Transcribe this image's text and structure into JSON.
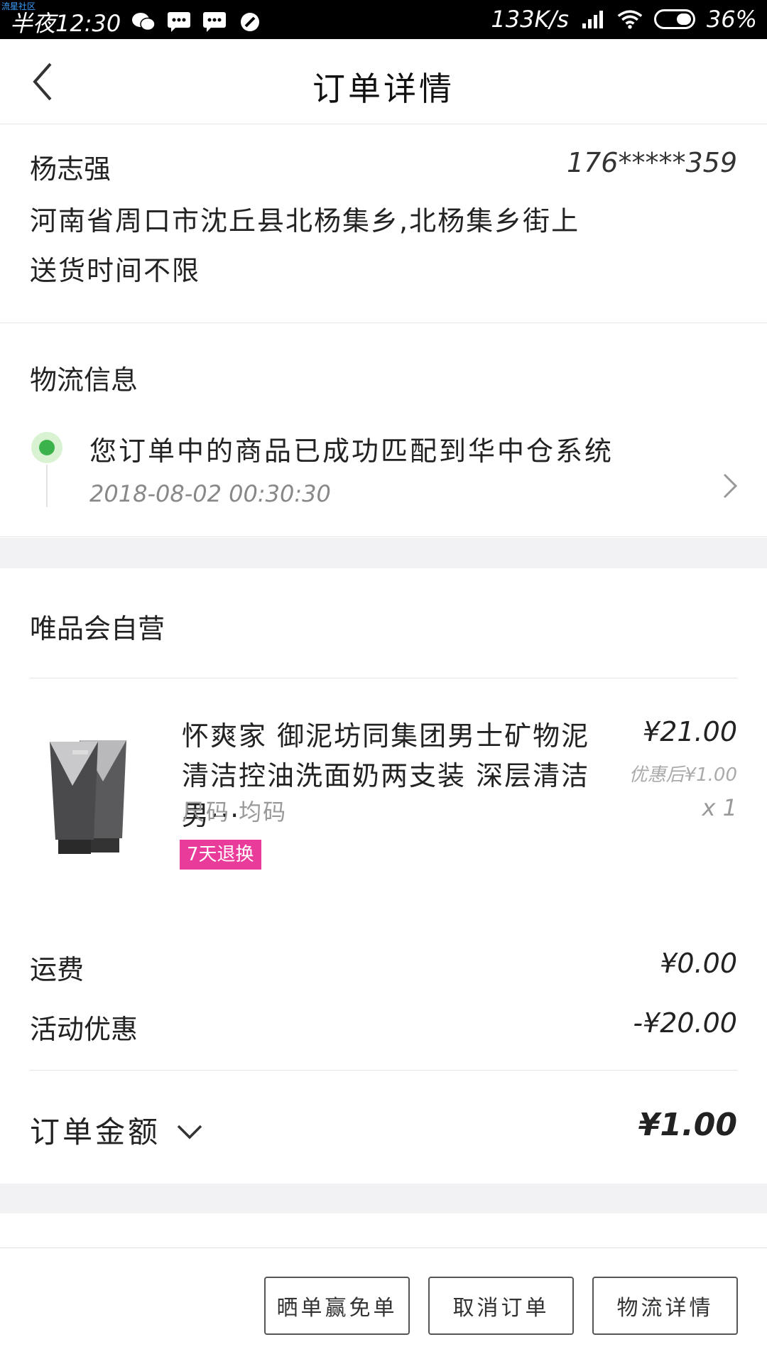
{
  "status_bar": {
    "watermark": "流星社区",
    "time": "半夜12:30",
    "speed": "133K/s",
    "battery": "36%"
  },
  "header": {
    "title": "订单详情"
  },
  "address": {
    "name": "杨志强",
    "phone": "176*****359",
    "line": "河南省周口市沈丘县北杨集乡,北杨集乡街上",
    "delivery_time": "送货时间不限"
  },
  "logistics": {
    "title": "物流信息",
    "message": "您订单中的商品已成功匹配到华中仓系统",
    "time": "2018-08-02 00:30:30"
  },
  "store": {
    "name": "唯品会自营"
  },
  "product": {
    "title": "怀爽家 御泥坊同集团男士矿物泥清洁控油洗面奶两支装 深层清洁 男···",
    "price": "¥21.00",
    "discount_price": "优惠后¥1.00",
    "size": "尺码 均码",
    "quantity": "x 1",
    "badge": "7天退换"
  },
  "fees": {
    "shipping_label": "运费",
    "shipping_value": "¥0.00",
    "promo_label": "活动优惠",
    "promo_value": "-¥20.00",
    "total_label": "订单金额",
    "total_value": "¥1.00"
  },
  "actions": {
    "share_label": "晒单赢免单",
    "cancel_label": "取消订单",
    "logistics_label": "物流详情"
  },
  "colors": {
    "badge": "#e93b9a",
    "logistics_dot": "#3cb34a",
    "section_gap": "#f2f2f4"
  }
}
